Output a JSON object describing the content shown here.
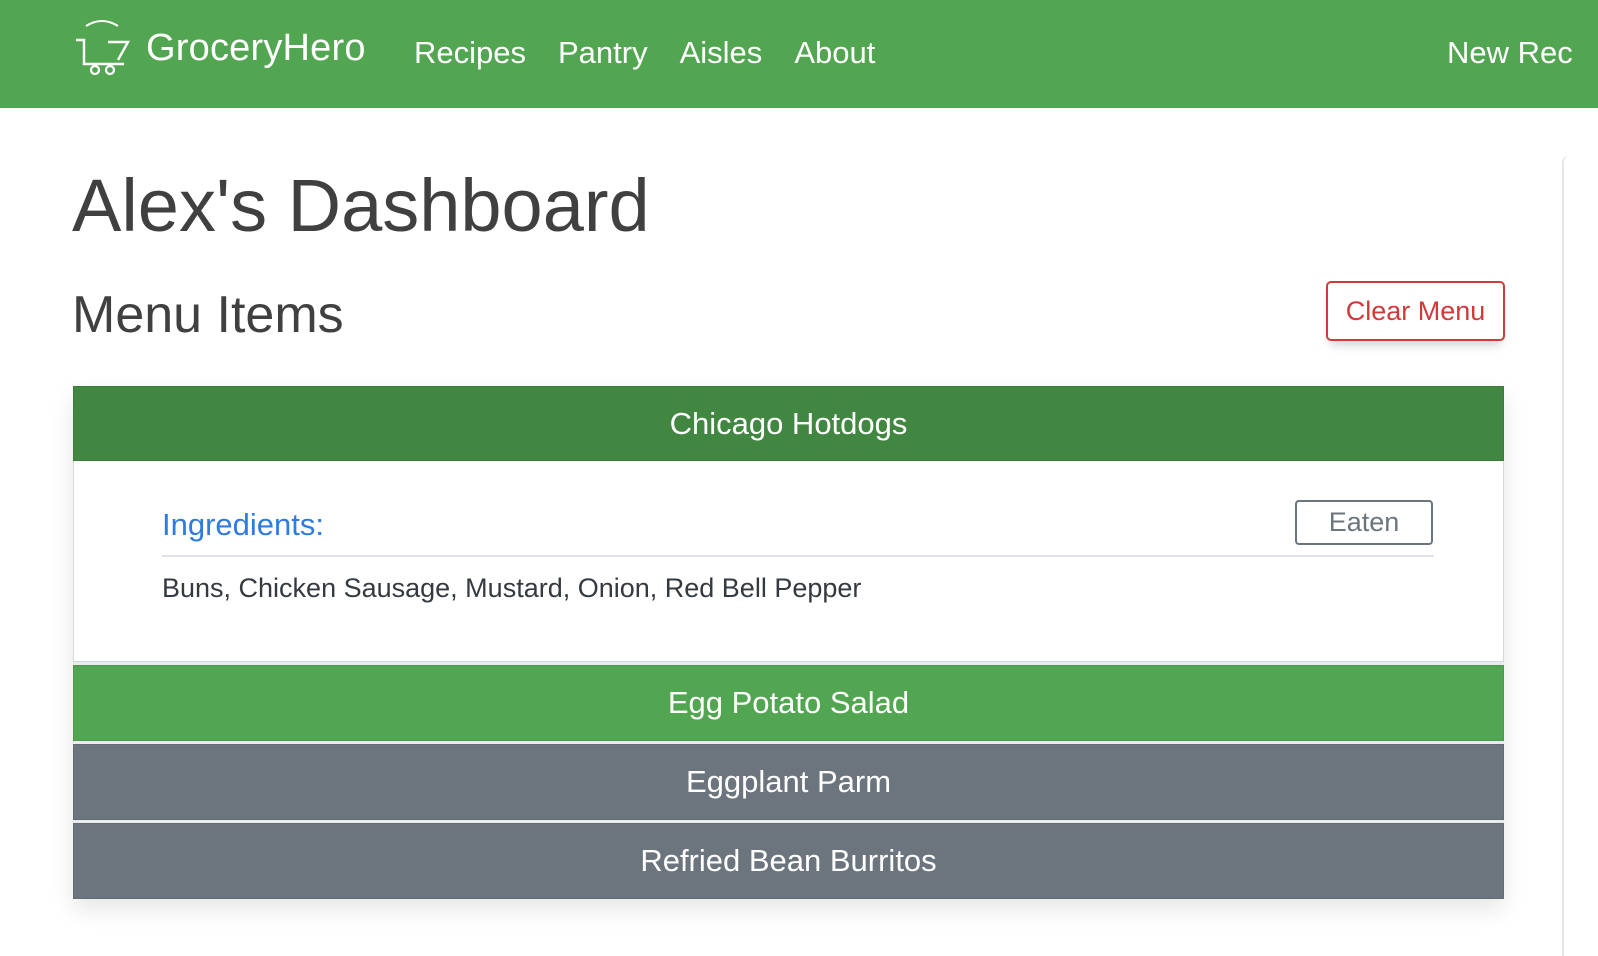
{
  "navbar": {
    "brand": "GroceryHero",
    "links": [
      "Recipes",
      "Pantry",
      "Aisles",
      "About"
    ],
    "right_link": "New Rec",
    "brand_color": "#53a651"
  },
  "main": {
    "title": "Alex's Dashboard",
    "section_title": "Menu Items",
    "clear_button": "Clear Menu"
  },
  "menu": {
    "items": [
      {
        "name": "Chicago Hotdogs",
        "expanded": true,
        "ingredients_label": "Ingredients:",
        "eaten_button": "Eaten",
        "ingredients": "Buns, Chicken Sausage, Mustard, Onion, Red Bell Pepper"
      },
      {
        "name": "Egg Potato Salad",
        "expanded": false
      },
      {
        "name": "Eggplant Parm",
        "expanded": false
      },
      {
        "name": "Refried Bean Burritos",
        "expanded": false
      }
    ]
  },
  "colors": {
    "active_header": "#418641",
    "green_header": "#53a651",
    "gray_header": "#6c757d",
    "danger": "#d03a3a",
    "link_blue": "#2f7be0"
  },
  "icons": {
    "brand_logo": "shopping-cart-icon"
  }
}
